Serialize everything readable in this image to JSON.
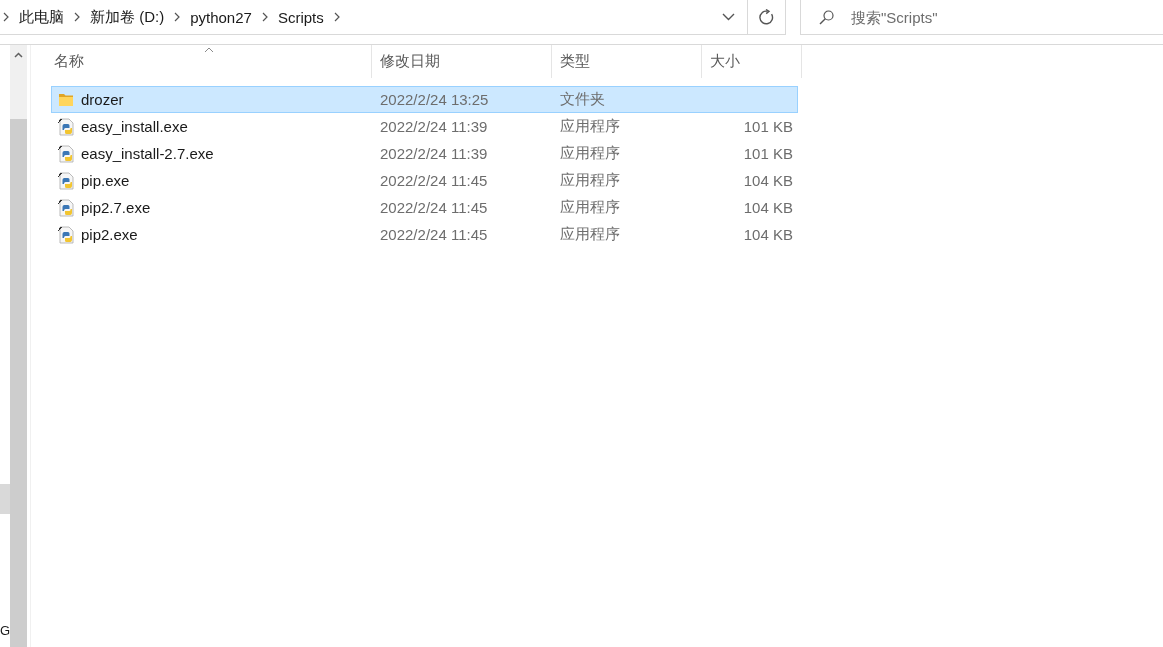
{
  "address_bar": {
    "breadcrumbs": [
      {
        "label": "此电脑"
      },
      {
        "label": "新加卷 (D:)"
      },
      {
        "label": "python27"
      },
      {
        "label": "Scripts"
      }
    ]
  },
  "search": {
    "placeholder": "搜索\"Scripts\""
  },
  "navigation_pane": {
    "items": [
      {
        "highlighted": true
      },
      {
        "label": "G",
        "highlighted": false
      }
    ]
  },
  "file_list": {
    "columns": [
      {
        "label": "名称",
        "sorted": true
      },
      {
        "label": "修改日期",
        "sorted": false
      },
      {
        "label": "类型",
        "sorted": false
      },
      {
        "label": "大小",
        "sorted": false
      }
    ],
    "rows": [
      {
        "kind": "folder",
        "name": "drozer",
        "modified": "2022/2/24 13:25",
        "type": "文件夹",
        "selected": true
      },
      {
        "kind": "application",
        "name": "easy_install.exe",
        "modified": "2022/2/24 11:39",
        "type": "应用程序",
        "size": "101 KB",
        "selected": false
      },
      {
        "kind": "application",
        "name": "easy_install-2.7.exe",
        "modified": "2022/2/24 11:39",
        "type": "应用程序",
        "size": "101 KB",
        "selected": false
      },
      {
        "kind": "application",
        "name": "pip.exe",
        "modified": "2022/2/24 11:45",
        "type": "应用程序",
        "size": "104 KB",
        "selected": false
      },
      {
        "kind": "application",
        "name": "pip2.7.exe",
        "modified": "2022/2/24 11:45",
        "type": "应用程序",
        "size": "104 KB",
        "selected": false
      },
      {
        "kind": "application",
        "name": "pip2.exe",
        "modified": "2022/2/24 11:45",
        "type": "应用程序",
        "size": "104 KB",
        "selected": false
      }
    ]
  }
}
